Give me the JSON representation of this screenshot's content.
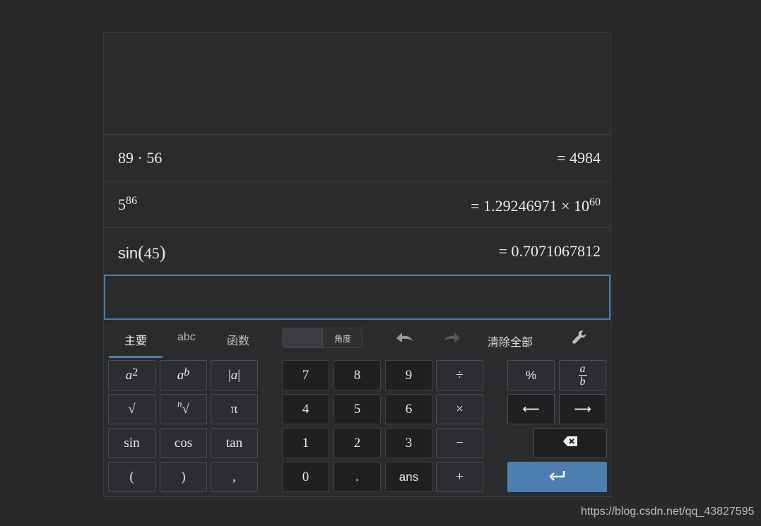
{
  "history": [
    {
      "expr_base": "89 · 56",
      "result": "= 4984"
    },
    {
      "expr_base": "5",
      "expr_sup": "86",
      "result_base": "= 1.29246971 × 10",
      "result_sup": "60"
    },
    {
      "expr_fn": "sin",
      "expr_open": "(",
      "expr_arg": "45",
      "expr_close": ")",
      "result": "= 0.7071067812"
    }
  ],
  "input": {
    "value": ""
  },
  "tabs": [
    {
      "label": "主要",
      "active": true
    },
    {
      "label": "abc",
      "active": false
    },
    {
      "label": "函数",
      "active": false
    }
  ],
  "angle_toggle": {
    "label": "角度"
  },
  "toolbar": {
    "undo_icon": "undo-icon",
    "redo_icon": "redo-icon",
    "clear_all": "清除全部",
    "settings_icon": "wrench-icon"
  },
  "keys": {
    "a_squared": {
      "base": "a",
      "sup": "2"
    },
    "a_pow_b": {
      "base": "a",
      "sup": "b"
    },
    "abs": {
      "left": "|",
      "var": "a",
      "right": "|"
    },
    "sqrt": "√",
    "nth_root": {
      "index": "n",
      "radical": "√"
    },
    "pi": "π",
    "sin": "sin",
    "cos": "cos",
    "tan": "tan",
    "lparen": "(",
    "rparen": ")",
    "comma": ",",
    "n7": "7",
    "n8": "8",
    "n9": "9",
    "div": "÷",
    "n4": "4",
    "n5": "5",
    "n6": "6",
    "mul": "×",
    "n1": "1",
    "n2": "2",
    "n3": "3",
    "sub": "−",
    "n0": "0",
    "dot": ".",
    "ans": "ans",
    "add": "+",
    "percent": "%",
    "fraction": {
      "num": "a",
      "den": "b"
    },
    "left_arrow": "⟵",
    "right_arrow": "⟶"
  },
  "watermark": "https://blog.csdn.net/qq_43827595",
  "colors": {
    "accent": "#4c7fb0",
    "background": "#28292b"
  }
}
